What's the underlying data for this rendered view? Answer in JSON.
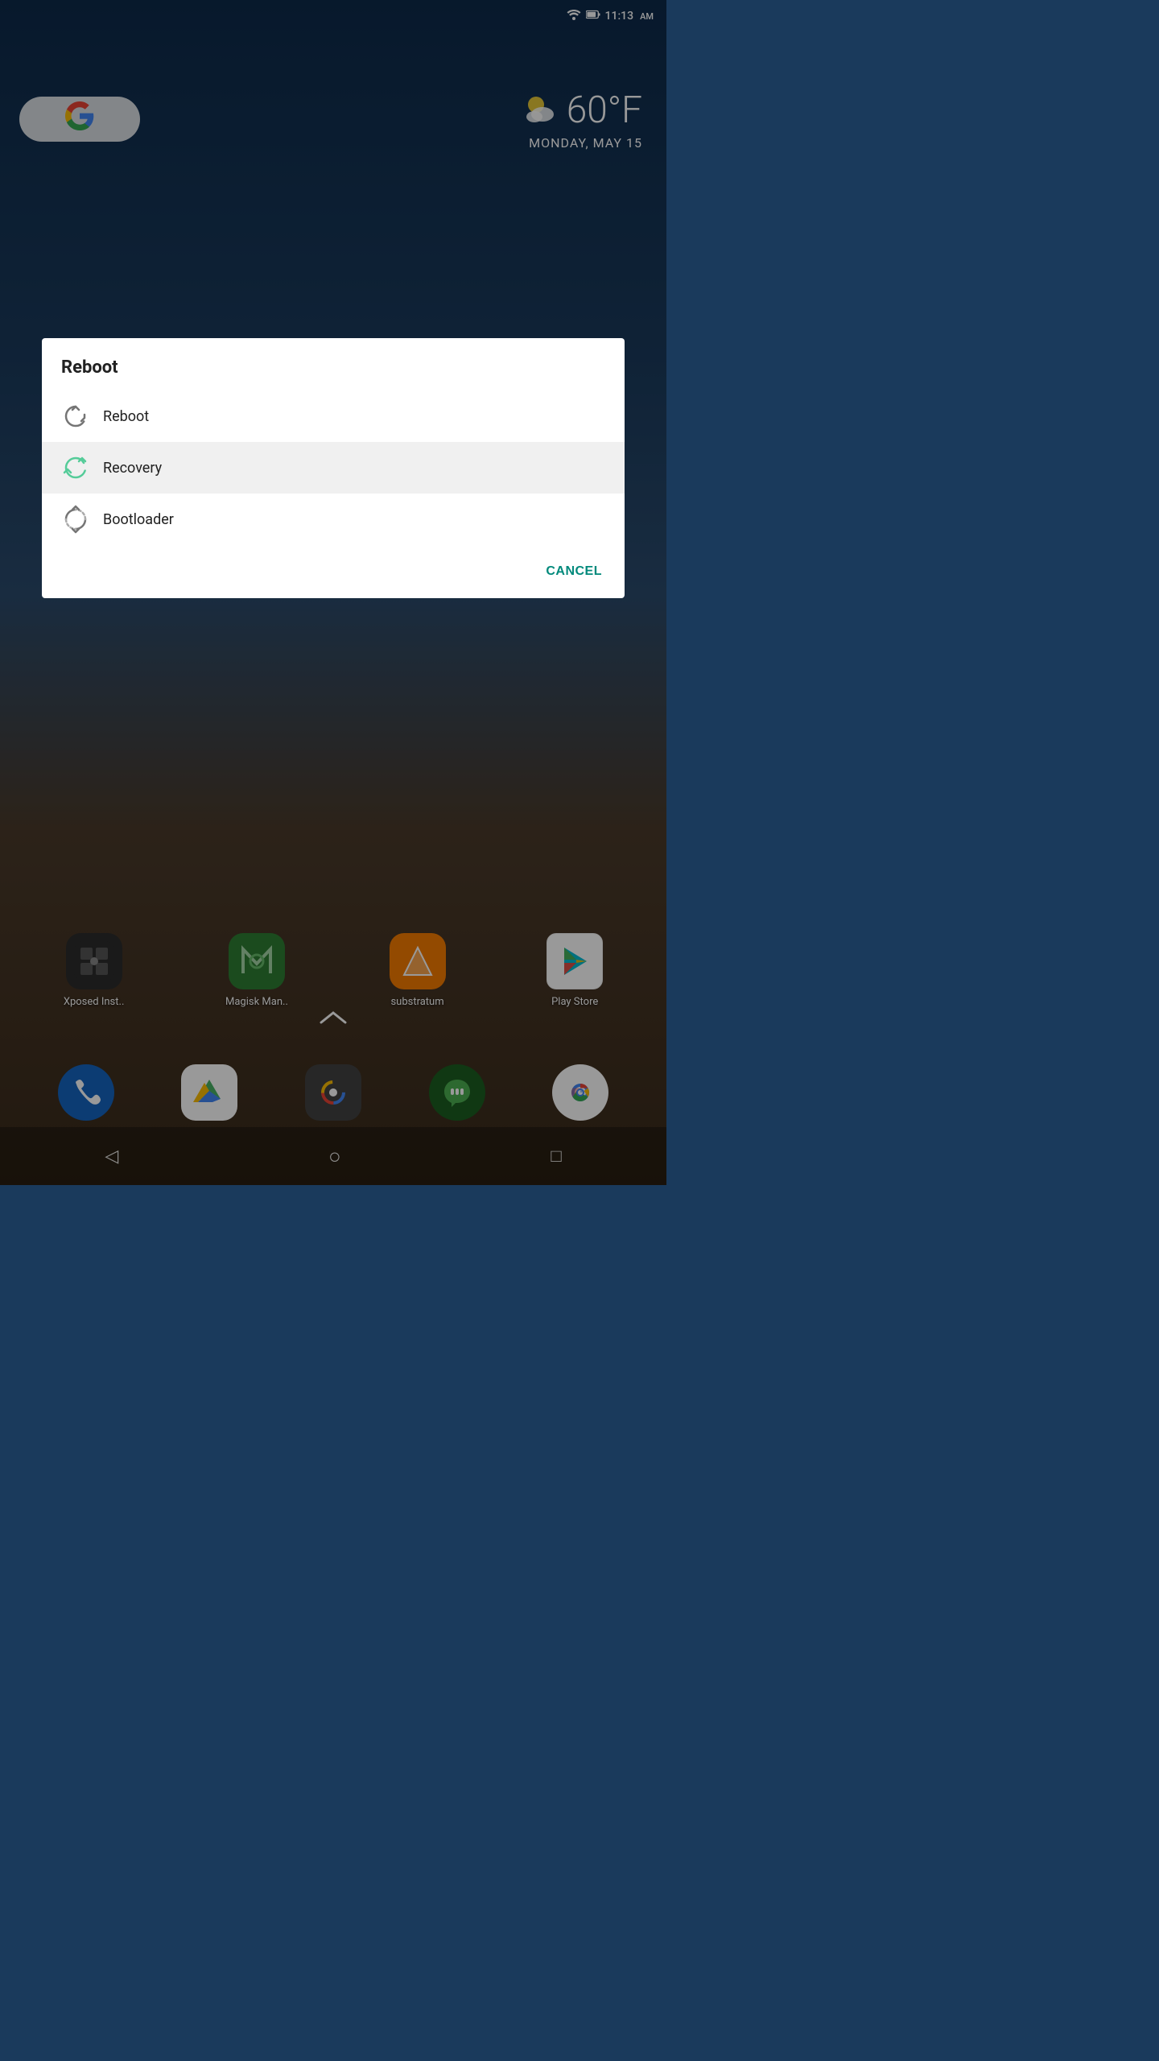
{
  "statusBar": {
    "time": "11:13",
    "ampm": "AM"
  },
  "weather": {
    "temperature": "60°F",
    "date": "MONDAY, MAY 15"
  },
  "dialog": {
    "title": "Reboot",
    "items": [
      {
        "id": "reboot",
        "label": "Reboot"
      },
      {
        "id": "recovery",
        "label": "Recovery"
      },
      {
        "id": "bootloader",
        "label": "Bootloader"
      }
    ],
    "cancelLabel": "CANCEL",
    "selectedIndex": 1
  },
  "appRow": {
    "apps": [
      {
        "id": "xposed",
        "label": "Xposed Inst.."
      },
      {
        "id": "magisk",
        "label": "Magisk Man.."
      },
      {
        "id": "substratum",
        "label": "substratum"
      },
      {
        "id": "playstore",
        "label": "Play Store"
      }
    ]
  },
  "dock": {
    "apps": [
      {
        "id": "phone",
        "label": ""
      },
      {
        "id": "drive",
        "label": ""
      },
      {
        "id": "camera",
        "label": ""
      },
      {
        "id": "hangouts",
        "label": ""
      },
      {
        "id": "chrome",
        "label": ""
      }
    ]
  },
  "navBar": {
    "back": "◁",
    "home": "○",
    "recents": "□"
  }
}
